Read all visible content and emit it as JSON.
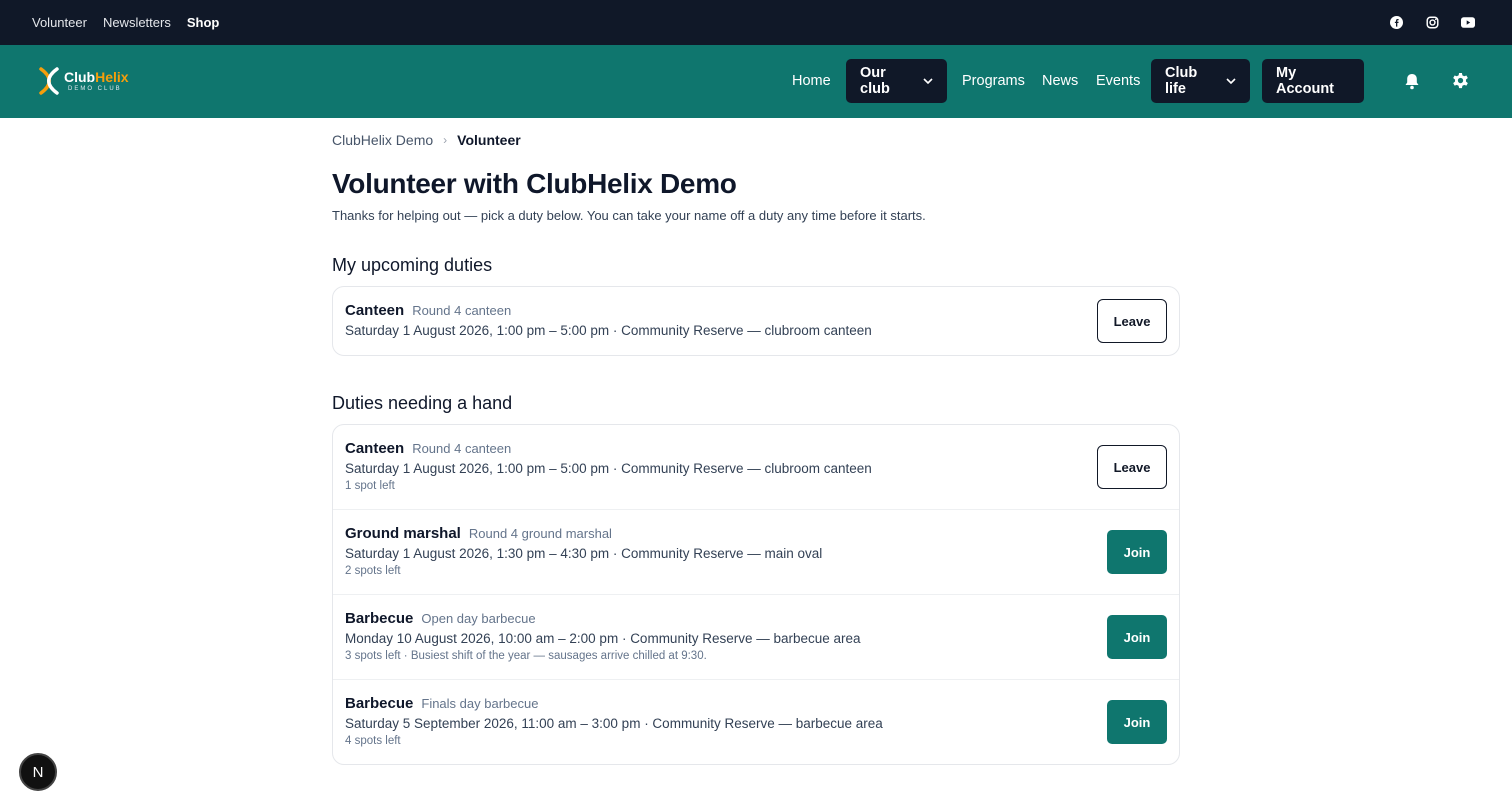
{
  "topbar": {
    "links": [
      "Volunteer",
      "Newsletters",
      "Shop"
    ],
    "social": [
      "facebook-icon",
      "instagram-icon",
      "youtube-icon"
    ]
  },
  "logo": {
    "brand_a": "Club",
    "brand_b": "Helix",
    "sub": "DEMO CLUB"
  },
  "nav": {
    "home": "Home",
    "our_club": "Our club",
    "programs": "Programs",
    "news": "News",
    "events": "Events",
    "club_life": "Club life",
    "my_account": "My Account",
    "icons": [
      "bell-icon",
      "gear-icon"
    ]
  },
  "breadcrumb": {
    "root": "ClubHelix Demo",
    "current": "Volunteer"
  },
  "page": {
    "title": "Volunteer with ClubHelix Demo",
    "intro": "Thanks for helping out — pick a duty below. You can take your name off a duty any time before it starts."
  },
  "upcoming": {
    "title": "My upcoming duties",
    "items": [
      {
        "name": "Canteen",
        "detail": "Round 4 canteen",
        "when": "Saturday 1 August 2026, 1:00 pm – 5:00 pm · Community Reserve — clubroom canteen",
        "action": "Leave"
      }
    ]
  },
  "needing": {
    "title": "Duties needing a hand",
    "items": [
      {
        "name": "Canteen",
        "detail": "Round 4 canteen",
        "when": "Saturday 1 August 2026, 1:00 pm – 5:00 pm · Community Reserve — clubroom canteen",
        "spots": "1 spot left",
        "action": "Leave"
      },
      {
        "name": "Ground marshal",
        "detail": "Round 4 ground marshal",
        "when": "Saturday 1 August 2026, 1:30 pm – 4:30 pm · Community Reserve — main oval",
        "spots": "2 spots left",
        "action": "Join"
      },
      {
        "name": "Barbecue",
        "detail": "Open day barbecue",
        "when": "Monday 10 August 2026, 10:00 am – 2:00 pm · Community Reserve — barbecue area",
        "spots": "3 spots left · Busiest shift of the year — sausages arrive chilled at 9:30.",
        "action": "Join"
      },
      {
        "name": "Barbecue",
        "detail": "Finals day barbecue",
        "when": "Saturday 5 September 2026, 11:00 am – 3:00 pm · Community Reserve — barbecue area",
        "spots": "4 spots left",
        "action": "Join"
      }
    ]
  },
  "fab": {
    "label": "N"
  },
  "colors": {
    "topbar": "#101828",
    "nav": "#0f766e",
    "accent": "#f59e0b",
    "dark_button": "#101828"
  }
}
